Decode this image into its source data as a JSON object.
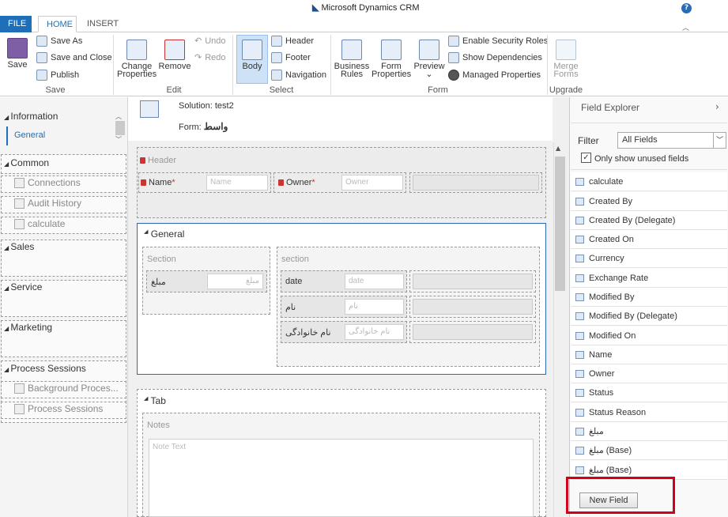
{
  "app": {
    "title": "Microsoft Dynamics CRM",
    "help": "?"
  },
  "tabs": {
    "file": "FILE",
    "home": "HOME",
    "insert": "INSERT"
  },
  "ribbon": {
    "save": {
      "save": "Save",
      "save_as": "Save As",
      "save_close": "Save and Close",
      "publish": "Publish",
      "label": "Save"
    },
    "edit": {
      "change_props_1": "Change",
      "change_props_2": "Properties",
      "remove": "Remove",
      "undo": "Undo",
      "redo": "Redo",
      "label": "Edit"
    },
    "select": {
      "body": "Body",
      "header": "Header",
      "footer": "Footer",
      "navigation": "Navigation",
      "label": "Select"
    },
    "form": {
      "business_rules_1": "Business",
      "business_rules_2": "Rules",
      "form_props_1": "Form",
      "form_props_2": "Properties",
      "preview": "Preview",
      "enable_security": "Enable Security Roles",
      "show_deps": "Show Dependencies",
      "managed_props": "Managed Properties",
      "label": "Form"
    },
    "upgrade": {
      "merge_1": "Merge",
      "merge_2": "Forms",
      "label": "Upgrade"
    }
  },
  "leftnav": {
    "information": "Information",
    "general": "General",
    "common": "Common",
    "connections": "Connections",
    "audit_history": "Audit History",
    "calculate": "calculate",
    "sales": "Sales",
    "service": "Service",
    "marketing": "Marketing",
    "process_sessions": "Process Sessions",
    "background_proc": "Background Proces...",
    "process_sessions_item": "Process Sessions"
  },
  "solution": {
    "label": "Solution: test2",
    "form_prefix": "Form:",
    "form_name": "واسط"
  },
  "form": {
    "header_label": "Header",
    "name_label": "Name",
    "name_ph": "Name",
    "owner_label": "Owner",
    "owner_ph": "Owner",
    "general_tab": "General",
    "section_left": "Section",
    "section_right": "section",
    "mablagh_label": "مبلغ",
    "mablagh_ph": "مبلغ",
    "date_label": "date",
    "date_ph": "date",
    "nam_label": "نام",
    "nam_ph": "نام",
    "family_label": "نام خانوادگی",
    "family_ph": "نام خانوادگی",
    "tab2": "Tab",
    "notes": "Notes",
    "note_text": "Note Text",
    "required": "*"
  },
  "field_explorer": {
    "title": "Field Explorer",
    "filter_label": "Filter",
    "filter_value": "All Fields",
    "unused_label": "Only show unused fields",
    "unused_checked": true,
    "items": [
      "calculate",
      "Created By",
      "Created By (Delegate)",
      "Created On",
      "Currency",
      "Exchange Rate",
      "Modified By",
      "Modified By (Delegate)",
      "Modified On",
      "Name",
      "Owner",
      "Status",
      "Status Reason",
      "مبلغ",
      "مبلغ (Base)",
      "مبلغ (Base)"
    ],
    "new_field": "New Field"
  },
  "colors": {
    "accent": "#1e6fb8",
    "highlight_box": "#d0021b"
  }
}
